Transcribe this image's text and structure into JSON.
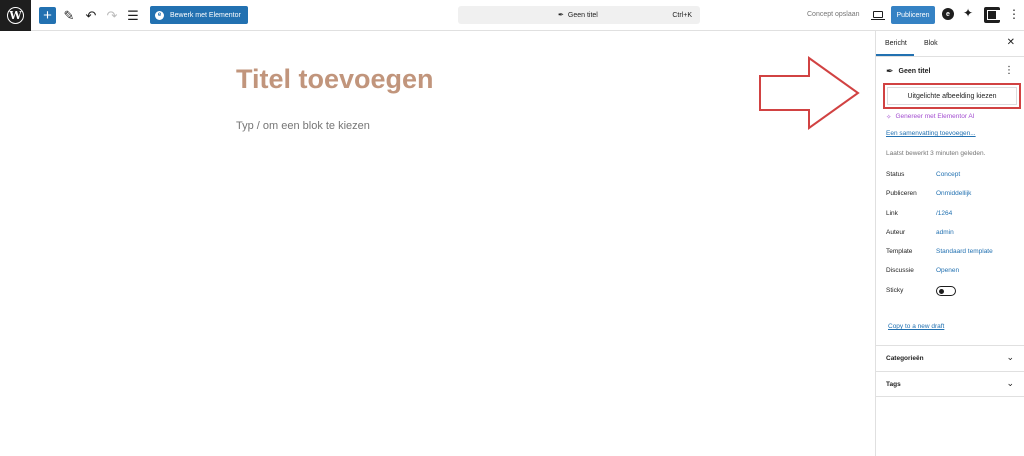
{
  "toolbar": {
    "add_label": "+",
    "elementor_label": "Bewerk met Elementor",
    "doc_title": "Geen titel",
    "shortcut": "Ctrl+K",
    "save_draft_label": "Concept opslaan",
    "publish_label": "Publiceren"
  },
  "editor": {
    "title_placeholder": "Titel toevoegen",
    "block_placeholder": "Typ / om een blok te kiezen"
  },
  "sidebar": {
    "tabs": [
      {
        "label": "Bericht"
      },
      {
        "label": "Blok"
      }
    ],
    "post_title": "Geen titel",
    "featured_image_label": "Uitgelichte afbeelding kiezen",
    "generate_ai_label": "Genereer met Elementor AI",
    "summary_link": "Een samenvatting toevoegen...",
    "last_edited": "Laatst bewerkt 3 minuten geleden.",
    "meta": [
      {
        "key": "Status",
        "value": "Concept"
      },
      {
        "key": "Publiceren",
        "value": "Onmiddellijk"
      },
      {
        "key": "Link",
        "value": "/1264"
      },
      {
        "key": "Auteur",
        "value": "admin"
      },
      {
        "key": "Template",
        "value": "Standaard template"
      },
      {
        "key": "Discussie",
        "value": "Openen"
      },
      {
        "key": "Sticky",
        "value": ""
      }
    ],
    "copy_draft_link": "Copy to a new draft",
    "panels": [
      {
        "label": "Categorieën"
      },
      {
        "label": "Tags"
      }
    ]
  },
  "colors": {
    "accent": "#2271b1",
    "title": "#c1957c",
    "annotation": "#d14242",
    "ai": "#a34dd0"
  },
  "icons": [
    "wordpress-logo",
    "pencil-icon",
    "undo-icon",
    "redo-icon",
    "list-view-icon",
    "feather-icon",
    "desktop-icon",
    "elementor-icon",
    "ai-sparkle-icon",
    "settings-panel-icon",
    "more-icon",
    "close-icon",
    "chevron-down-icon"
  ]
}
